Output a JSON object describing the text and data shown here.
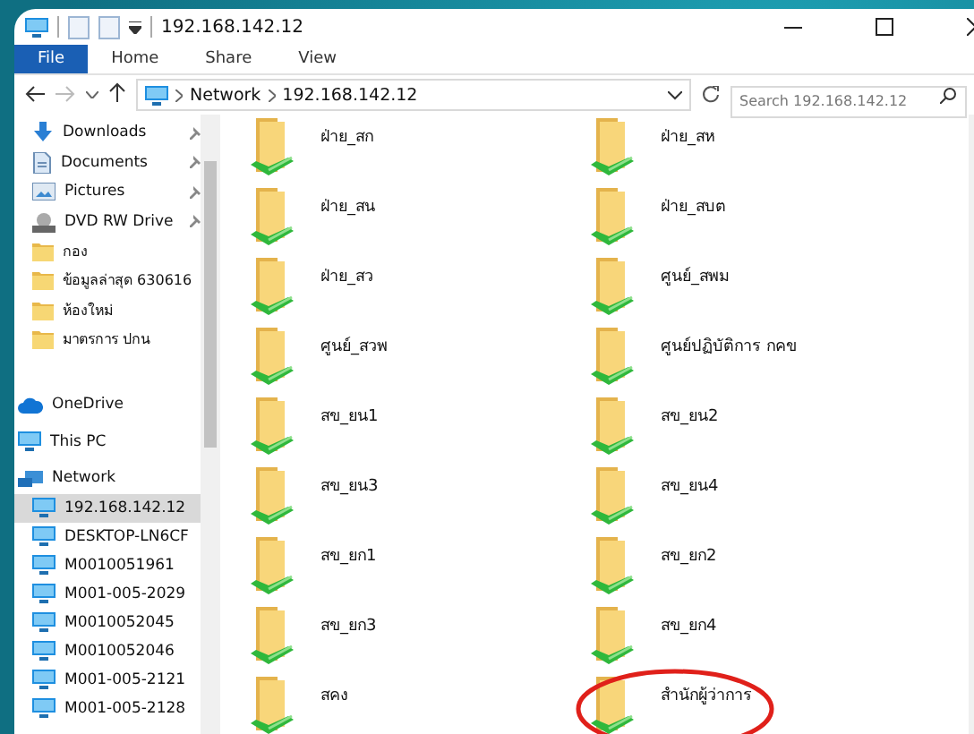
{
  "window": {
    "title": "192.168.142.12"
  },
  "ribbon_tabs": [
    {
      "label": "File",
      "selected": true
    },
    {
      "label": "Home",
      "selected": false
    },
    {
      "label": "Share",
      "selected": false
    },
    {
      "label": "View",
      "selected": false
    }
  ],
  "address_bar": {
    "path": [
      "Network",
      "192.168.142.12"
    ]
  },
  "search": {
    "placeholder": "Search 192.168.142.12"
  },
  "sidebar": {
    "quick_access": [
      {
        "label": "Downloads",
        "kind": "downloads",
        "pinned": true
      },
      {
        "label": "Documents",
        "kind": "documents",
        "pinned": true
      },
      {
        "label": "Pictures",
        "kind": "pictures",
        "pinned": true
      },
      {
        "label": "DVD RW Drive",
        "kind": "dvd",
        "pinned": true
      },
      {
        "label": "กอง",
        "kind": "folder",
        "pinned": false
      },
      {
        "label": "ข้อมูลล่าสุด 630616",
        "kind": "folder",
        "pinned": false
      },
      {
        "label": "ห้องใหม่",
        "kind": "folder",
        "pinned": false
      },
      {
        "label": "มาตรการ ปกน",
        "kind": "folder",
        "pinned": false
      }
    ],
    "roots": [
      {
        "label": "OneDrive",
        "kind": "onedrive"
      },
      {
        "label": "This PC",
        "kind": "pc"
      }
    ],
    "network": {
      "label": "Network",
      "children": [
        {
          "label": "192.168.142.12",
          "selected": true
        },
        {
          "label": "DESKTOP-LN6CF",
          "selected": false
        },
        {
          "label": "M0010051961",
          "selected": false
        },
        {
          "label": "M001-005-2029",
          "selected": false
        },
        {
          "label": "M0010052045",
          "selected": false
        },
        {
          "label": "M0010052046",
          "selected": false
        },
        {
          "label": "M001-005-2121",
          "selected": false
        },
        {
          "label": "M001-005-2128",
          "selected": false
        }
      ]
    }
  },
  "shares": [
    {
      "name": "ฝ่าย_สก",
      "circled": false
    },
    {
      "name": "ฝ่าย_สห",
      "circled": false
    },
    {
      "name": "ฝ่าย_สน",
      "circled": false
    },
    {
      "name": "ฝ่าย_สบต",
      "circled": false
    },
    {
      "name": "ฝ่าย_สว",
      "circled": false
    },
    {
      "name": "ศูนย์_สพม",
      "circled": false
    },
    {
      "name": "ศูนย์_สวพ",
      "circled": false
    },
    {
      "name": "ศูนย์ปฏิบัติการ กคข",
      "circled": false
    },
    {
      "name": "สข_ยน1",
      "circled": false
    },
    {
      "name": "สข_ยน2",
      "circled": false
    },
    {
      "name": "สข_ยน3",
      "circled": false
    },
    {
      "name": "สข_ยน4",
      "circled": false
    },
    {
      "name": "สข_ยก1",
      "circled": false
    },
    {
      "name": "สข_ยก2",
      "circled": false
    },
    {
      "name": "สข_ยก3",
      "circled": false
    },
    {
      "name": "สข_ยก4",
      "circled": false
    },
    {
      "name": "สคง",
      "circled": false
    },
    {
      "name": "สำนักผู้ว่าการ",
      "circled": true
    }
  ]
}
